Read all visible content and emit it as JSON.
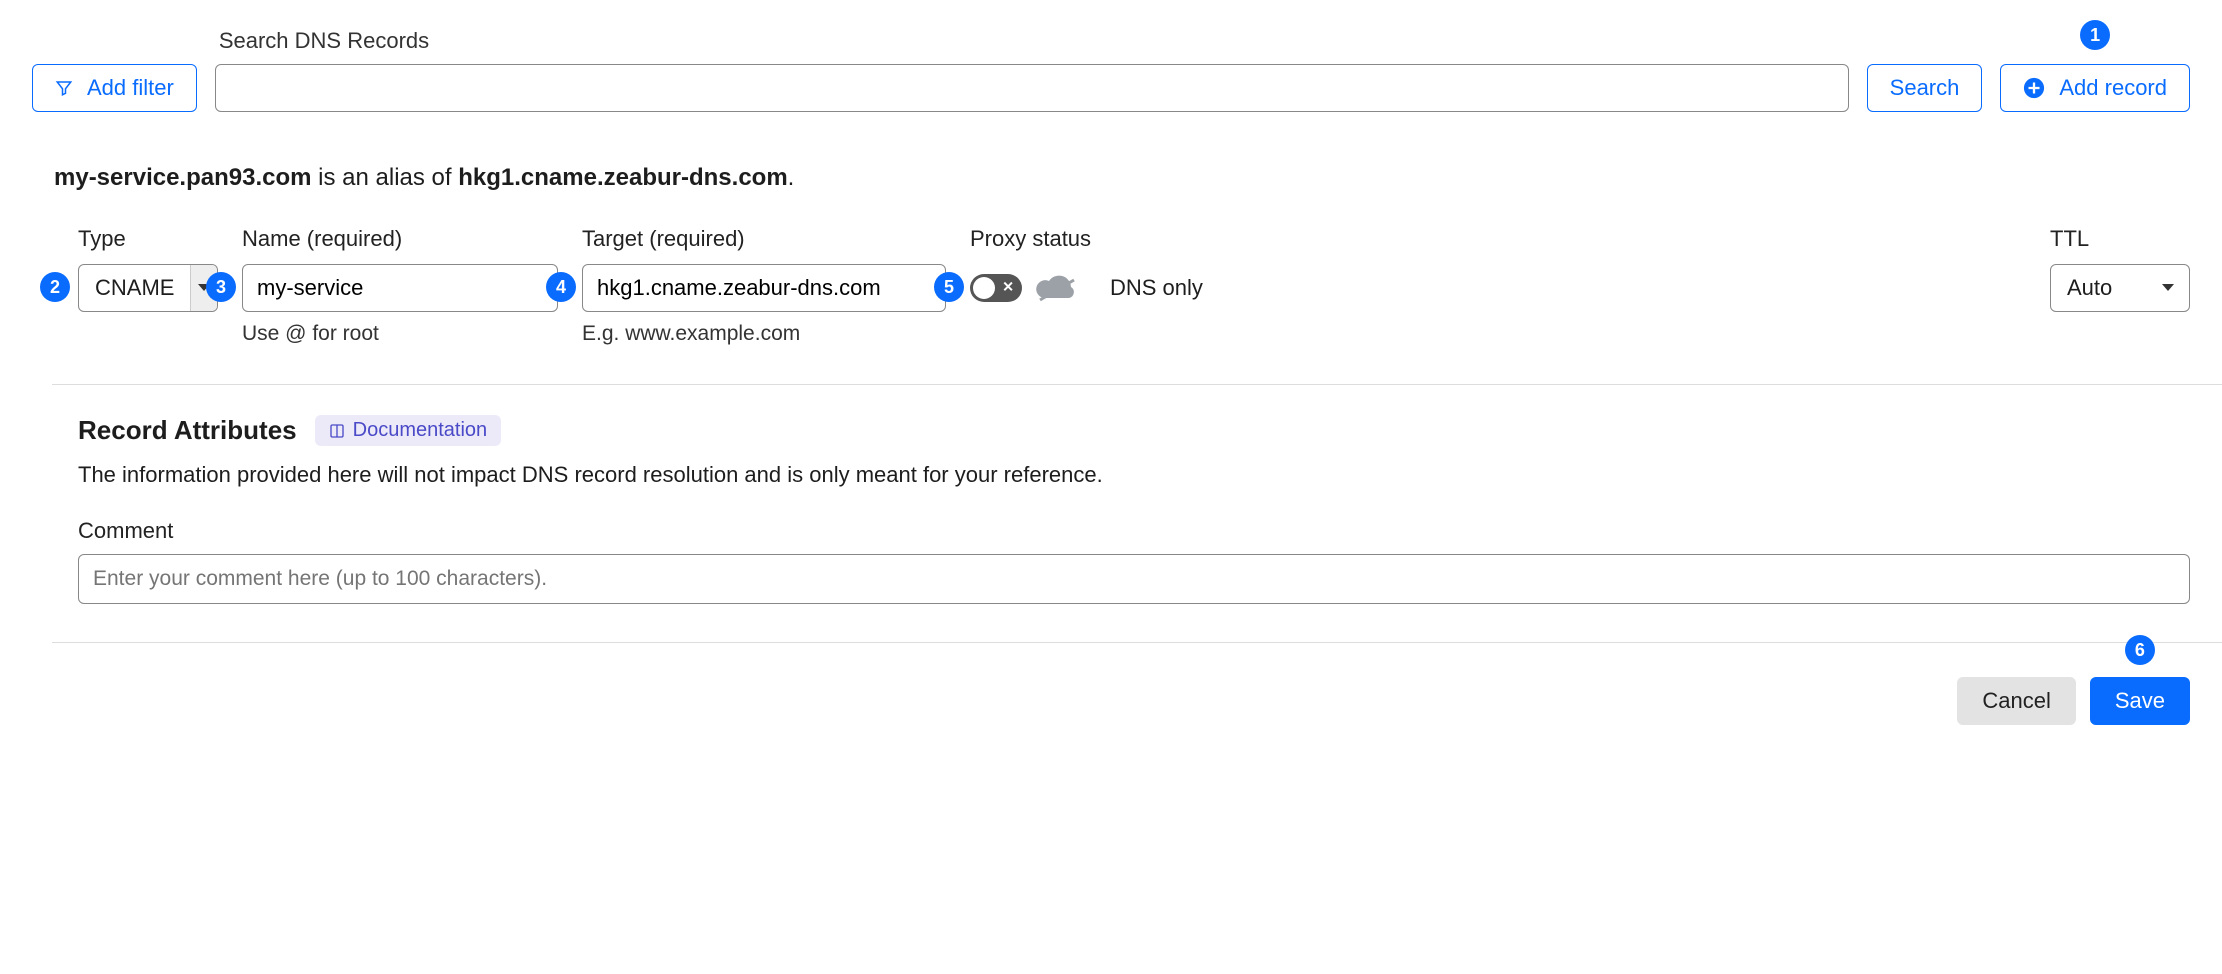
{
  "top": {
    "add_filter": "Add filter",
    "search_label": "Search DNS Records",
    "search_button": "Search",
    "add_record": "Add record"
  },
  "summary": {
    "domain": "my-service.pan93.com",
    "middle": " is an alias of ",
    "target": "hkg1.cname.zeabur-dns.com",
    "tail": "."
  },
  "steps": {
    "s1": "1",
    "s2": "2",
    "s3": "3",
    "s4": "4",
    "s5": "5",
    "s6": "6"
  },
  "form": {
    "type_label": "Type",
    "type_value": "CNAME",
    "name_label": "Name (required)",
    "name_value": "my-service",
    "name_hint": "Use @ for root",
    "target_label": "Target (required)",
    "target_value": "hkg1.cname.zeabur-dns.com",
    "target_hint": "E.g. www.example.com",
    "proxy_label": "Proxy status",
    "proxy_text": "DNS only",
    "ttl_label": "TTL",
    "ttl_value": "Auto"
  },
  "attrs": {
    "heading": "Record Attributes",
    "doc_link": "Documentation",
    "desc": "The information provided here will not impact DNS record resolution and is only meant for your reference.",
    "comment_label": "Comment",
    "comment_placeholder": "Enter your comment here (up to 100 characters)."
  },
  "footer": {
    "cancel": "Cancel",
    "save": "Save"
  }
}
